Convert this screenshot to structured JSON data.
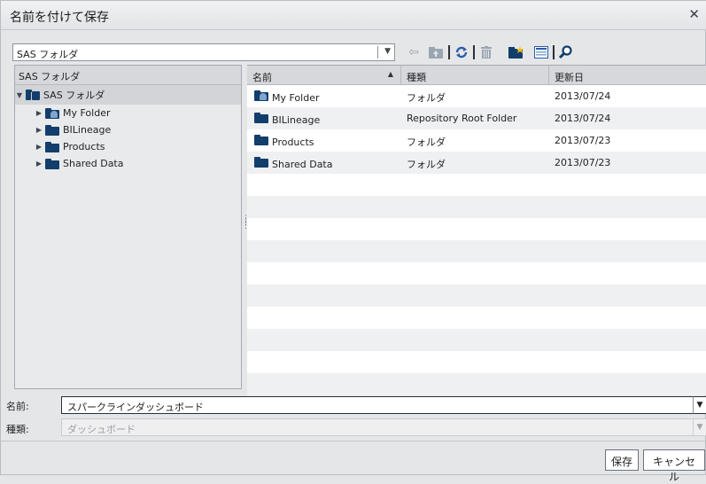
{
  "dialog": {
    "title": "名前を付けて保存"
  },
  "location": {
    "value": "SAS フォルダ"
  },
  "toolbar": {
    "icons": [
      "back-arrow-icon",
      "up-folder-icon",
      "refresh-icon",
      "delete-icon",
      "new-folder-icon",
      "view-options-icon",
      "search-icon"
    ]
  },
  "tree": {
    "header": "SAS フォルダ",
    "root": "SAS フォルダ",
    "items": [
      {
        "label": "My Folder",
        "icon": "user-folder-icon"
      },
      {
        "label": "BILineage",
        "icon": "folder-icon"
      },
      {
        "label": "Products",
        "icon": "folder-icon"
      },
      {
        "label": "Shared Data",
        "icon": "folder-icon"
      }
    ]
  },
  "list": {
    "columns": [
      "名前",
      "種類",
      "更新日"
    ],
    "rows": [
      {
        "name": "My Folder",
        "type": "フォルダ",
        "modified": "2013/07/24",
        "icon": "user-folder-icon"
      },
      {
        "name": "BILineage",
        "type": "Repository Root Folder",
        "modified": "2013/07/24",
        "icon": "folder-icon"
      },
      {
        "name": "Products",
        "type": "フォルダ",
        "modified": "2013/07/23",
        "icon": "folder-icon"
      },
      {
        "name": "Shared Data",
        "type": "フォルダ",
        "modified": "2013/07/23",
        "icon": "folder-icon"
      }
    ]
  },
  "form": {
    "name_label": "名前:",
    "name_value": "スパークラインダッシュボード",
    "type_label": "種類:",
    "type_value": "ダッシュボード"
  },
  "buttons": {
    "save": "保存",
    "cancel": "キャンセル"
  },
  "colors": {
    "folder": "#123e6b",
    "accent": "#2a5ca8"
  }
}
